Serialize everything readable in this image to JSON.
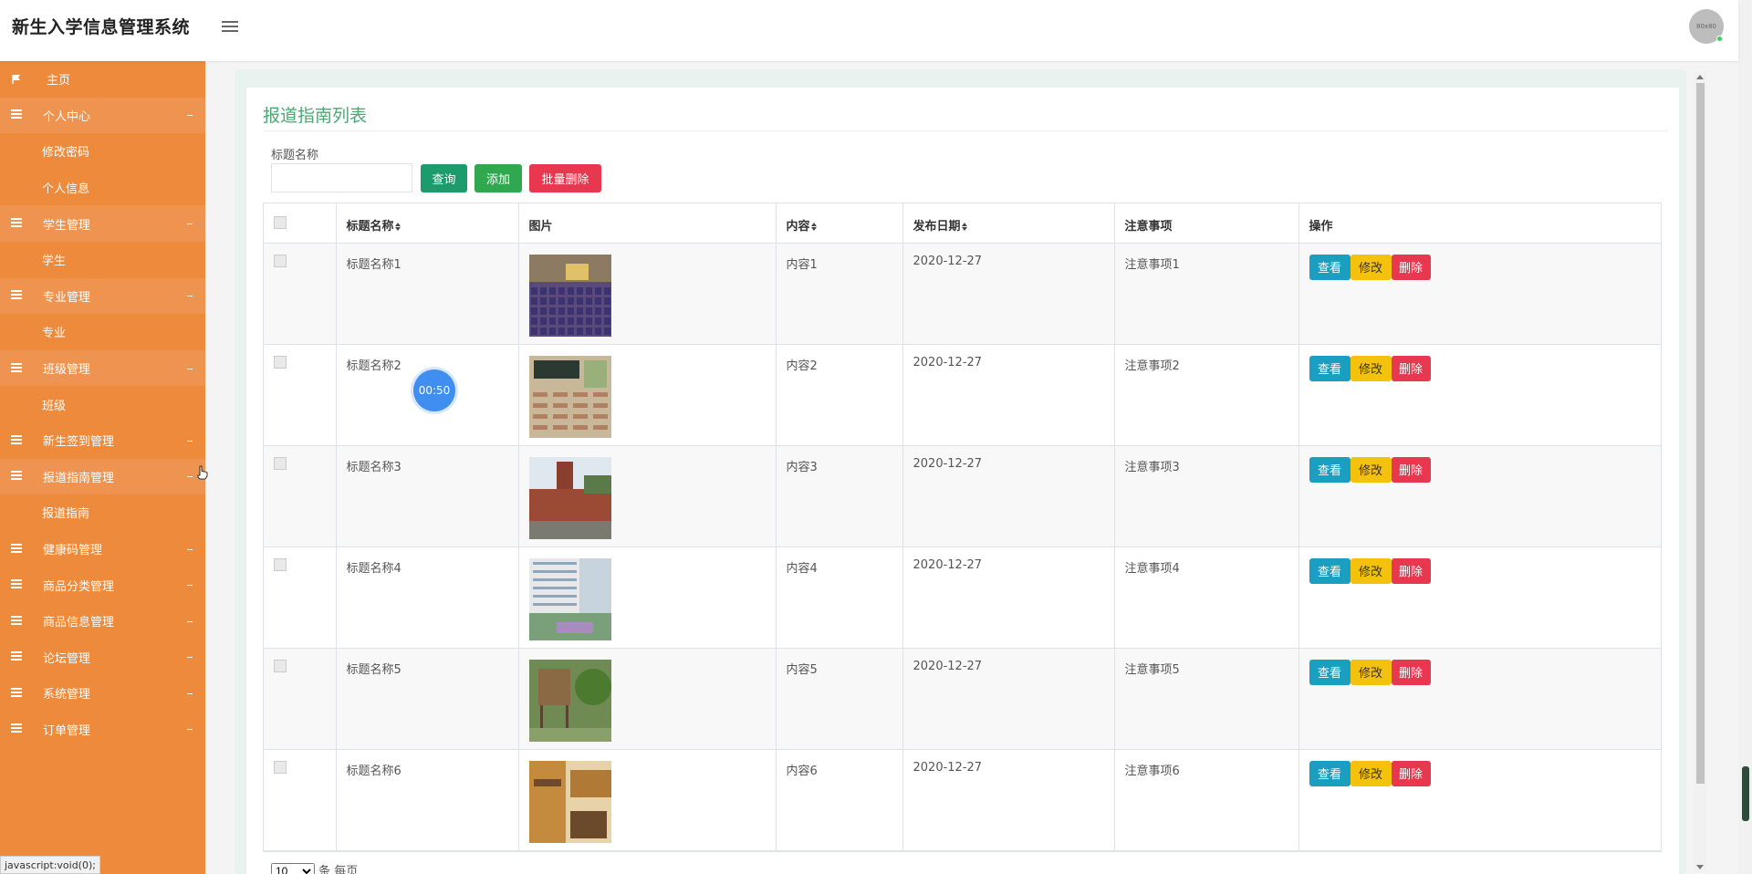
{
  "app": {
    "title": "新生入学信息管理系统",
    "avatar_text": "80x80"
  },
  "sidebar": {
    "items": [
      {
        "label": "主页",
        "type": "home"
      },
      {
        "label": "个人中心",
        "type": "parent"
      },
      {
        "label": "修改密码",
        "type": "sub"
      },
      {
        "label": "个人信息",
        "type": "sub"
      },
      {
        "label": "学生管理",
        "type": "parent"
      },
      {
        "label": "学生",
        "type": "sub"
      },
      {
        "label": "专业管理",
        "type": "parent"
      },
      {
        "label": "专业",
        "type": "sub"
      },
      {
        "label": "班级管理",
        "type": "parent"
      },
      {
        "label": "班级",
        "type": "sub"
      },
      {
        "label": "新生签到管理",
        "type": "closed"
      },
      {
        "label": "报道指南管理",
        "type": "parent"
      },
      {
        "label": "报道指南",
        "type": "sub"
      },
      {
        "label": "健康码管理",
        "type": "closed"
      },
      {
        "label": "商品分类管理",
        "type": "closed"
      },
      {
        "label": "商品信息管理",
        "type": "closed"
      },
      {
        "label": "论坛管理",
        "type": "closed"
      },
      {
        "label": "系统管理",
        "type": "closed"
      },
      {
        "label": "订单管理",
        "type": "closed"
      }
    ]
  },
  "main": {
    "panel_title": "报道指南列表",
    "search": {
      "label": "标题名称",
      "value": "",
      "placeholder": ""
    },
    "buttons": {
      "query": "查询",
      "add": "添加",
      "batch_delete": "批量删除"
    },
    "table": {
      "headers": [
        "标题名称",
        "图片",
        "内容",
        "发布日期",
        "注意事项",
        "操作"
      ],
      "rows": [
        {
          "title": "标题名称1",
          "content": "内容1",
          "date": "2020-12-27",
          "note": "注意事项1",
          "img": "auditorium"
        },
        {
          "title": "标题名称2",
          "content": "内容2",
          "date": "2020-12-27",
          "note": "注意事项2",
          "img": "classroom"
        },
        {
          "title": "标题名称3",
          "content": "内容3",
          "date": "2020-12-27",
          "note": "注意事项3",
          "img": "campus-tower"
        },
        {
          "title": "标题名称4",
          "content": "内容4",
          "date": "2020-12-27",
          "note": "注意事项4",
          "img": "building"
        },
        {
          "title": "标题名称5",
          "content": "内容5",
          "date": "2020-12-27",
          "note": "注意事项5",
          "img": "garden"
        },
        {
          "title": "标题名称6",
          "content": "内容6",
          "date": "2020-12-27",
          "note": "注意事项6",
          "img": "dorm"
        }
      ],
      "row_actions": {
        "view": "查看",
        "edit": "修改",
        "delete": "删除"
      }
    },
    "page_size": {
      "value": "10",
      "suffix": "条 每页"
    }
  },
  "timer": {
    "text": "00:50"
  },
  "status_bar": {
    "text": "javascript:void(0);"
  },
  "colors": {
    "sidebar": "#ee8a3c",
    "accent": "#4aa872",
    "view": "#1b9fc0",
    "edit": "#f4c20d",
    "delete": "#e8384f"
  }
}
